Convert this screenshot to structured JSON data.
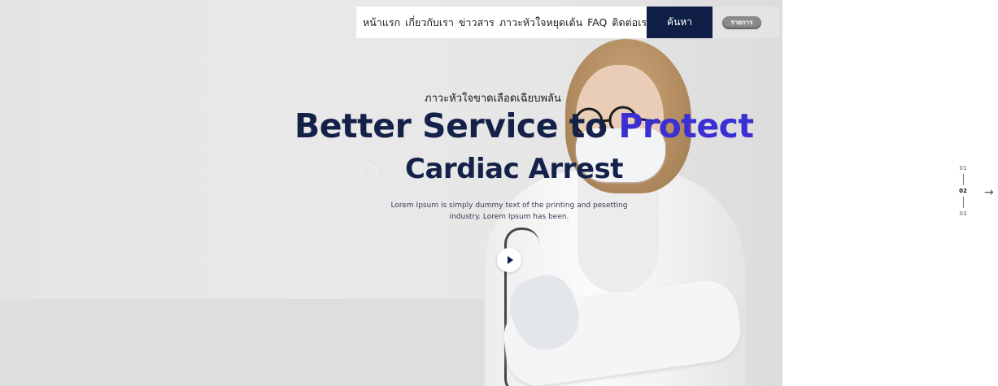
{
  "nav": {
    "links": [
      "หน้าแรก",
      "เกี่ยวกับเรา",
      "ข่าวสาร",
      "ภาวะหัวใจหยุดเต้น",
      "FAQ",
      "ติดต่อเรา"
    ],
    "search_label": "ค้นหา",
    "pill_label": "รายการ"
  },
  "hero": {
    "subtitle": "ภาวะหัวใจขาดเลือดเฉียบพลัน",
    "headline_main": "Better Service to ",
    "headline_accent": "Protect",
    "headline_line2": "Cardiac Arrest",
    "description": "Lorem Ipsum is simply dummy text of the printing and pesetting industry. Lorem Ipsum has been."
  },
  "pager": {
    "items": [
      "01",
      "02",
      "03"
    ],
    "active": "02"
  },
  "colors": {
    "navy": "#0f1f45",
    "accent": "#3b2fd4"
  },
  "icons": {
    "play": "play-icon",
    "next": "arrow-right-icon"
  }
}
